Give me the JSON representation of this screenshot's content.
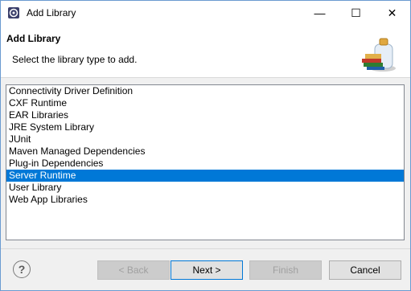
{
  "window": {
    "title": "Add Library",
    "controls": {
      "minimize": "—",
      "maximize": "☐",
      "close": "✕"
    }
  },
  "header": {
    "title": "Add Library",
    "description": "Select the library type to add."
  },
  "library_types": [
    "Connectivity Driver Definition",
    "CXF Runtime",
    "EAR Libraries",
    "JRE System Library",
    "JUnit",
    "Maven Managed Dependencies",
    "Plug-in Dependencies",
    "Server Runtime",
    "User Library",
    "Web App Libraries"
  ],
  "selected_index": 7,
  "buttons": {
    "help": "?",
    "back": "< Back",
    "next": "Next >",
    "finish": "Finish",
    "cancel": "Cancel"
  },
  "colors": {
    "selection": "#0078d7",
    "default_button_border": "#0078d7"
  }
}
